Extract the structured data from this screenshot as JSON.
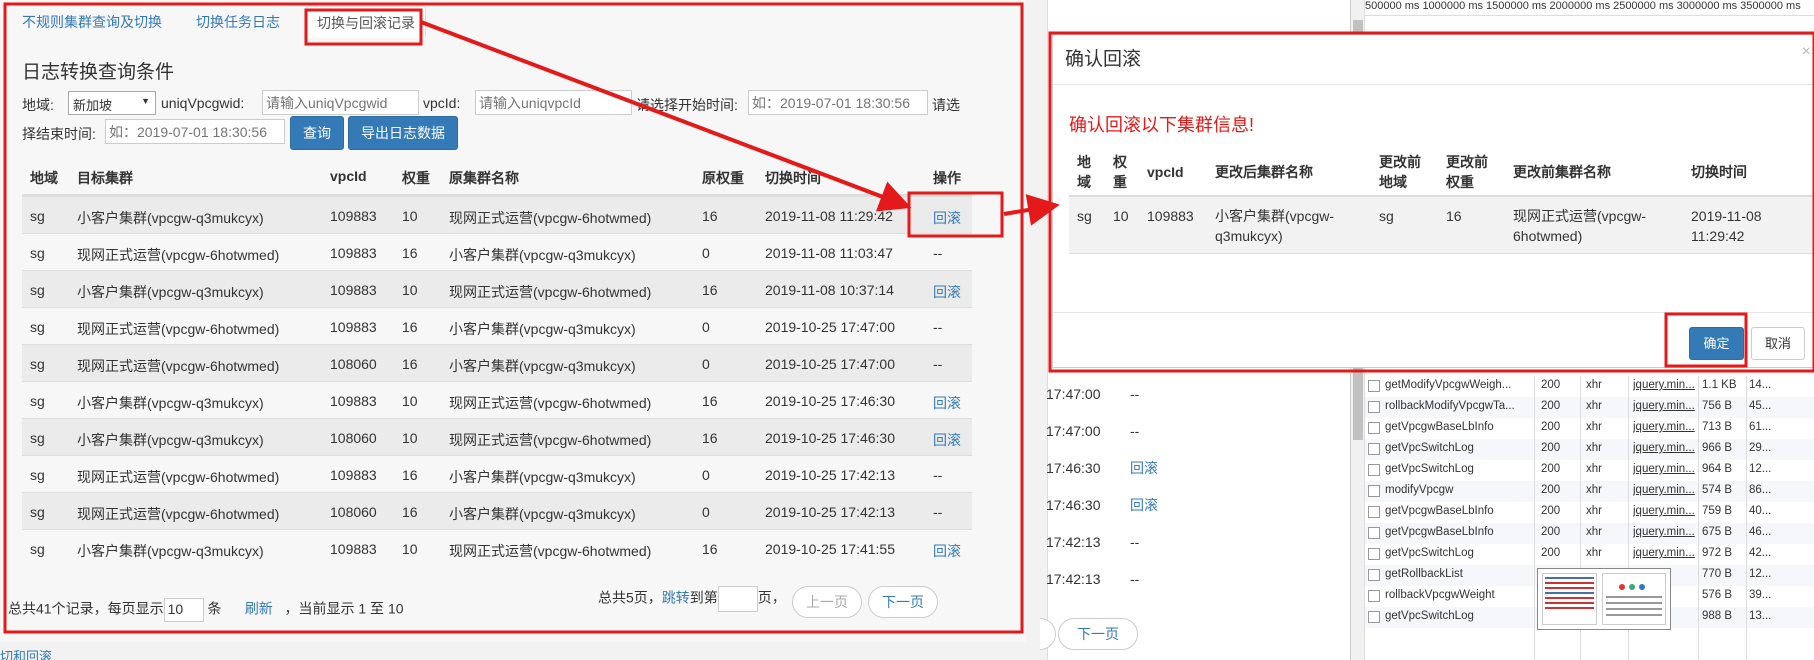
{
  "tabs": [
    {
      "label": "不规则集群查询及切换"
    },
    {
      "label": "切换任务日志"
    },
    {
      "label": "切换与回滚记录"
    }
  ],
  "form": {
    "title": "日志转换查询条件",
    "region_label": "地域:",
    "region_value": "新加坡",
    "uniq_label": "uniqVpcgwid:",
    "uniq_placeholder": "请输入uniqVpcgwid",
    "vpcid_label": "vpcId:",
    "vpcid_placeholder": "请输入uniqvpcId",
    "start_label": "请选择开始时间:",
    "start_placeholder": "如：2019-07-01 18:30:56",
    "end_label_a": "请选",
    "end_label_b": "择结束时间:",
    "end_placeholder": "如：2019-07-01 18:30:56",
    "query_button": "查询",
    "export_button": "导出日志数据"
  },
  "table": {
    "headers": [
      "地域",
      "目标集群",
      "vpcId",
      "权重",
      "原集群名称",
      "原权重",
      "切换时间",
      "操作"
    ],
    "rows": [
      [
        "sg",
        "小客户集群(vpcgw-q3mukcyx)",
        "109883",
        "10",
        "现网正式运营(vpcgw-6hotwmed)",
        "16",
        "2019-11-08 11:29:42",
        "回滚"
      ],
      [
        "sg",
        "现网正式运营(vpcgw-6hotwmed)",
        "109883",
        "16",
        "小客户集群(vpcgw-q3mukcyx)",
        "0",
        "2019-11-08 11:03:47",
        "--"
      ],
      [
        "sg",
        "小客户集群(vpcgw-q3mukcyx)",
        "109883",
        "10",
        "现网正式运营(vpcgw-6hotwmed)",
        "16",
        "2019-11-08 10:37:14",
        "回滚"
      ],
      [
        "sg",
        "现网正式运营(vpcgw-6hotwmed)",
        "109883",
        "16",
        "小客户集群(vpcgw-q3mukcyx)",
        "0",
        "2019-10-25 17:47:00",
        "--"
      ],
      [
        "sg",
        "现网正式运营(vpcgw-6hotwmed)",
        "108060",
        "16",
        "小客户集群(vpcgw-q3mukcyx)",
        "0",
        "2019-10-25 17:47:00",
        "--"
      ],
      [
        "sg",
        "小客户集群(vpcgw-q3mukcyx)",
        "109883",
        "10",
        "现网正式运营(vpcgw-6hotwmed)",
        "16",
        "2019-10-25 17:46:30",
        "回滚"
      ],
      [
        "sg",
        "小客户集群(vpcgw-q3mukcyx)",
        "108060",
        "10",
        "现网正式运营(vpcgw-6hotwmed)",
        "16",
        "2019-10-25 17:46:30",
        "回滚"
      ],
      [
        "sg",
        "现网正式运营(vpcgw-6hotwmed)",
        "109883",
        "16",
        "小客户集群(vpcgw-q3mukcyx)",
        "0",
        "2019-10-25 17:42:13",
        "--"
      ],
      [
        "sg",
        "现网正式运营(vpcgw-6hotwmed)",
        "108060",
        "16",
        "小客户集群(vpcgw-q3mukcyx)",
        "0",
        "2019-10-25 17:42:13",
        "--"
      ],
      [
        "sg",
        "小客户集群(vpcgw-q3mukcyx)",
        "109883",
        "10",
        "现网正式运营(vpcgw-6hotwmed)",
        "16",
        "2019-10-25 17:41:55",
        "回滚"
      ]
    ]
  },
  "pager": {
    "summary_a": "总共41个记录，每页显示",
    "page_size": "10",
    "summary_b": "条",
    "refresh": "刷新",
    "summary_c": "，当前显示 1 至 10",
    "pages_a": "总共5页，",
    "jump": "跳转",
    "pages_b": "到第",
    "pages_c": "页，",
    "prev": "上一页",
    "next": "下一页"
  },
  "modal": {
    "title": "确认回滚",
    "close": "×",
    "warning": "确认回滚以下集群信息!",
    "headers": [
      [
        "地",
        "域"
      ],
      [
        "权",
        "重"
      ],
      [
        "vpcId"
      ],
      [
        "更改后集群名称"
      ],
      [
        "更改前",
        "地域"
      ],
      [
        "更改前",
        "权重"
      ],
      [
        "更改前集群名称"
      ],
      [
        "切换时间"
      ]
    ],
    "row": [
      [
        "sg"
      ],
      [
        "10"
      ],
      [
        "109883"
      ],
      [
        "小客户集群(vpcgw-",
        "q3mukcyx)"
      ],
      [
        "sg"
      ],
      [
        "16"
      ],
      [
        "现网正式运营(vpcgw-",
        "6hotwmed)"
      ],
      [
        "2019-11-08",
        "11:29:42"
      ]
    ],
    "ok": "确定",
    "cancel": "取消"
  },
  "background": {
    "peek_rows": [
      [
        "17:47:00",
        "--"
      ],
      [
        "17:47:00",
        "--"
      ],
      [
        "17:46:30",
        "回滚"
      ],
      [
        "17:46:30",
        "回滚"
      ],
      [
        "17:42:13",
        "--"
      ],
      [
        "17:42:13",
        "--"
      ]
    ],
    "next": "下一页",
    "bottom_link": "切和回滚"
  },
  "devtools": {
    "timeline": [
      "500000 ms",
      "1000000 ms",
      "1500000 ms",
      "2000000 ms",
      "2500000 ms",
      "3000000 ms",
      "3500000 ms"
    ],
    "requests": [
      [
        "getModifyVpcgwWeigh...",
        "200",
        "xhr",
        "jquery.min...",
        "1.1 KB",
        "14..."
      ],
      [
        "rollbackModifyVpcgwTa...",
        "200",
        "xhr",
        "jquery.min...",
        "756 B",
        "45..."
      ],
      [
        "getVpcgwBaseLbInfo",
        "200",
        "xhr",
        "jquery.min...",
        "713 B",
        "61..."
      ],
      [
        "getVpcSwitchLog",
        "200",
        "xhr",
        "jquery.min...",
        "966 B",
        "29..."
      ],
      [
        "getVpcSwitchLog",
        "200",
        "xhr",
        "jquery.min...",
        "964 B",
        "12..."
      ],
      [
        "modifyVpcgw",
        "200",
        "xhr",
        "jquery.min...",
        "574 B",
        "86..."
      ],
      [
        "getVpcgwBaseLbInfo",
        "200",
        "xhr",
        "jquery.min...",
        "759 B",
        "40..."
      ],
      [
        "getVpcgwBaseLbInfo",
        "200",
        "xhr",
        "jquery.min...",
        "675 B",
        "46..."
      ],
      [
        "getVpcSwitchLog",
        "200",
        "xhr",
        "jquery.min...",
        "972 B",
        "42..."
      ],
      [
        "getRollbackList",
        "20",
        "",
        "",
        "770 B",
        "12..."
      ],
      [
        "rollbackVpcgwWeight",
        "20",
        "",
        "",
        "576 B",
        "39..."
      ],
      [
        "getVpcSwitchLog",
        "20",
        "",
        "",
        "988 B",
        "13..."
      ]
    ]
  },
  "colors": {
    "annotation_red": "#e41a1a",
    "link_blue": "#337ab7",
    "primary_blue": "#337ab7"
  }
}
